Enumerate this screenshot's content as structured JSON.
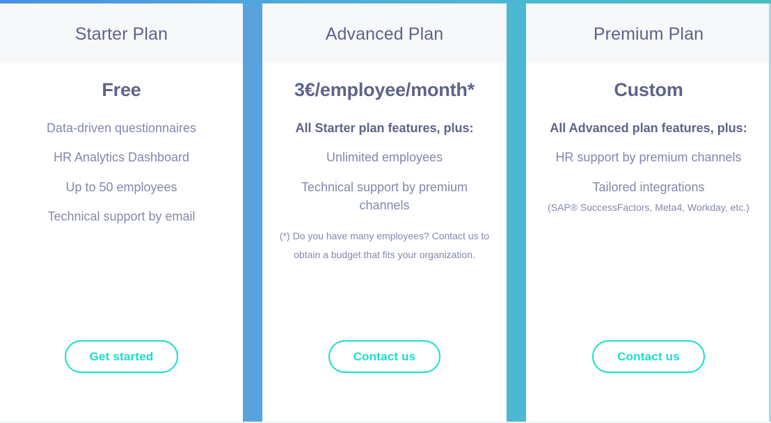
{
  "theme": {
    "gradient_start": "#4a90e2",
    "gradient_end": "#45bfbf",
    "divider_left_color": "#58a3dd",
    "divider_right_color": "#4bb8d4",
    "header_band_color": "#f7f8fa",
    "heading_color": "#5e6389",
    "body_text_color": "#8288ab",
    "cta_color": "#17e0ce"
  },
  "plans": [
    {
      "name": "Starter Plan",
      "price": "Free",
      "features": [
        {
          "text": "Data-driven questionnaires",
          "bold": false
        },
        {
          "text": "HR Analytics Dashboard",
          "bold": false
        },
        {
          "text": "Up to 50 employees",
          "bold": false
        },
        {
          "text": "Technical support by email",
          "bold": false
        }
      ],
      "note": "",
      "footnote": "",
      "cta_label": "Get started"
    },
    {
      "name": "Advanced Plan",
      "price": "3€/employee/month*",
      "features": [
        {
          "text": "All Starter plan features, plus:",
          "bold": true
        },
        {
          "text": "Unlimited employees",
          "bold": false
        },
        {
          "text": "Technical support by premium channels",
          "bold": false
        }
      ],
      "note": "",
      "footnote": "(*) Do you have many employees? Contact us to obtain a budget that fits your organization.",
      "cta_label": "Contact us"
    },
    {
      "name": "Premium Plan",
      "price": "Custom",
      "features": [
        {
          "text": "All Advanced plan features, plus:",
          "bold": true
        },
        {
          "text": "HR support by premium channels",
          "bold": false
        },
        {
          "text": "Tailored integrations",
          "bold": false
        }
      ],
      "note": "(SAP® SuccessFactors, Meta4, Workday, etc.)",
      "footnote": "",
      "cta_label": "Contact us"
    }
  ]
}
